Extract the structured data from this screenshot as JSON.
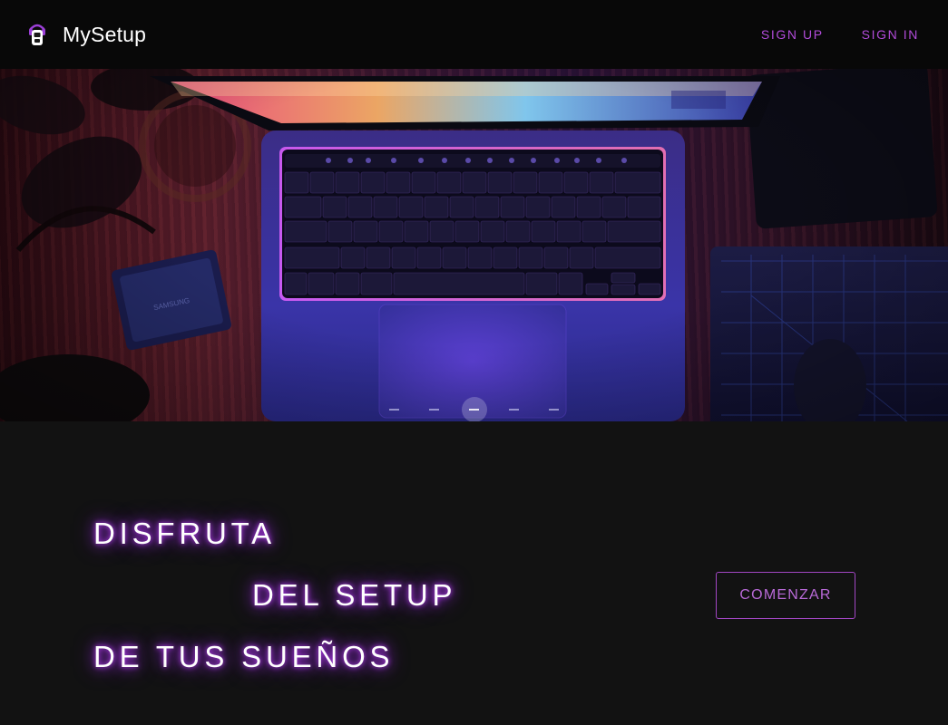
{
  "header": {
    "brand_name": "MySetup",
    "logo_icon": "robot-icon",
    "nav": [
      {
        "label": "SIGN UP"
      },
      {
        "label": "SIGN IN"
      }
    ]
  },
  "hero": {
    "image": "laptop-on-desk-photo",
    "carousel": {
      "slides": 5,
      "active_index": 3
    }
  },
  "headline": {
    "lines": [
      "DISFRUTA",
      "DEL SETUP",
      "DE TUS SUEÑOS"
    ],
    "cta_label": "COMENZAR"
  },
  "colors": {
    "accent": "#b04bd8",
    "background": "#121212",
    "header_background": "#080808",
    "glow": "#c040ff"
  }
}
